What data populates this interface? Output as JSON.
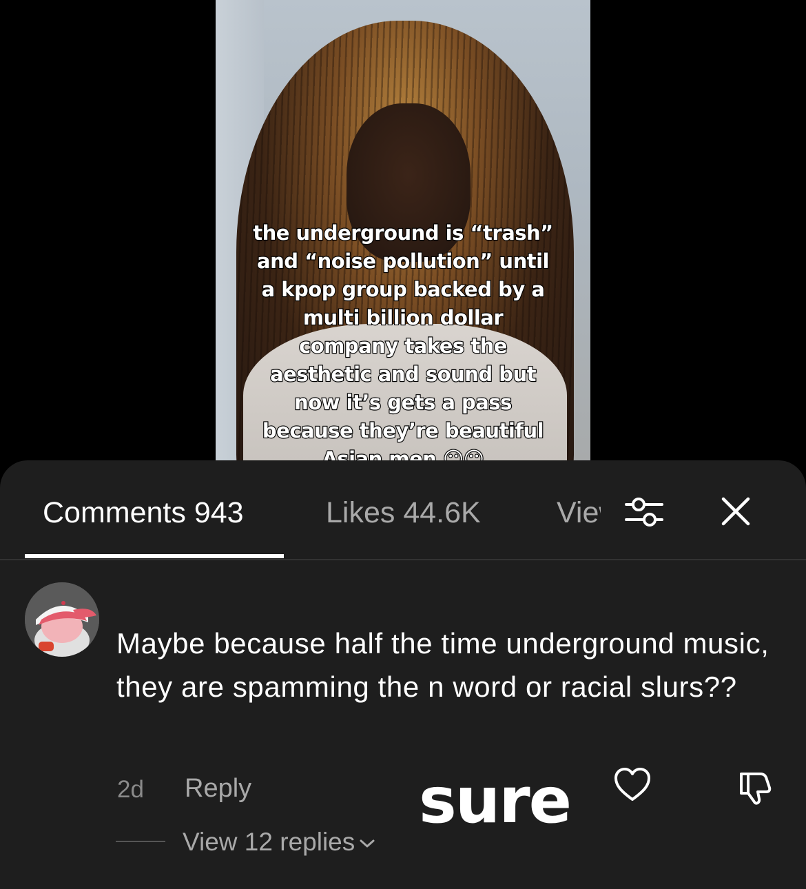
{
  "video": {
    "caption": "the underground is “trash”\nand “noise pollution” until\na kpop group backed by a\nmulti billion dollar\ncompany takes the\naesthetic and sound but\nnow it’s gets a pass\nbecause they’re beautiful\nAsian men 😶😶"
  },
  "tabs": {
    "comments": "Comments 943",
    "likes": "Likes 44.6K",
    "views": "Views",
    "active": "comments"
  },
  "icons": {
    "filter": "filter-sliders-icon",
    "close": "close-icon",
    "like": "heart-outline-icon",
    "dislike": "thumbs-down-icon",
    "chevron": "chevron-down-icon"
  },
  "comment": {
    "text": "Maybe because half the time underground music, they are spamming the n word or racial slurs??",
    "time": "2d",
    "reply_label": "Reply",
    "view_replies": "View 12 replies"
  },
  "overlay": {
    "word": "sure"
  },
  "colors": {
    "sheet_bg": "#1e1e1e",
    "muted_text": "#a9a9a9",
    "active_text": "#ffffff"
  }
}
